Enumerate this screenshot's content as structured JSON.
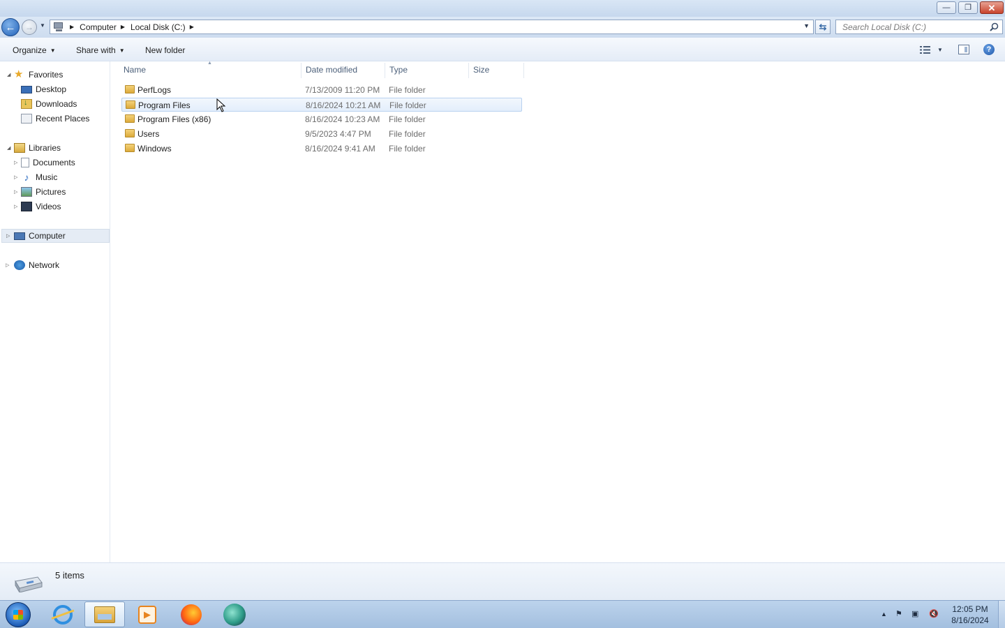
{
  "window": {
    "controls": {
      "minimize": "—",
      "maximize": "❐",
      "close": "✕"
    }
  },
  "address": {
    "crumbs": [
      "Computer",
      "Local Disk (C:)"
    ],
    "search_placeholder": "Search Local Disk (C:)"
  },
  "toolbar": {
    "organize": "Organize",
    "share_with": "Share with",
    "new_folder": "New folder"
  },
  "nav": {
    "favorites": {
      "label": "Favorites",
      "items": [
        "Desktop",
        "Downloads",
        "Recent Places"
      ]
    },
    "libraries": {
      "label": "Libraries",
      "items": [
        "Documents",
        "Music",
        "Pictures",
        "Videos"
      ]
    },
    "computer": "Computer",
    "network": "Network"
  },
  "columns": {
    "name": "Name",
    "date": "Date modified",
    "type": "Type",
    "size": "Size"
  },
  "files": [
    {
      "name": "PerfLogs",
      "date": "7/13/2009 11:20 PM",
      "type": "File folder"
    },
    {
      "name": "Program Files",
      "date": "8/16/2024 10:21 AM",
      "type": "File folder"
    },
    {
      "name": "Program Files (x86)",
      "date": "8/16/2024 10:23 AM",
      "type": "File folder"
    },
    {
      "name": "Users",
      "date": "9/5/2023 4:47 PM",
      "type": "File folder"
    },
    {
      "name": "Windows",
      "date": "8/16/2024 9:41 AM",
      "type": "File folder"
    }
  ],
  "status": {
    "item_count": "5 items"
  },
  "taskbar": {
    "apps": [
      "internet-explorer-icon",
      "windows-explorer-icon",
      "media-player-icon",
      "firefox-icon",
      "app-icon"
    ],
    "time": "12:05 PM",
    "date": "8/16/2024"
  },
  "colors": {
    "title_bar": "#d9e6f5",
    "taskbar": "#b4cce8",
    "hover_row_border": "#b8d1f0",
    "close_button": "#c8432c"
  }
}
